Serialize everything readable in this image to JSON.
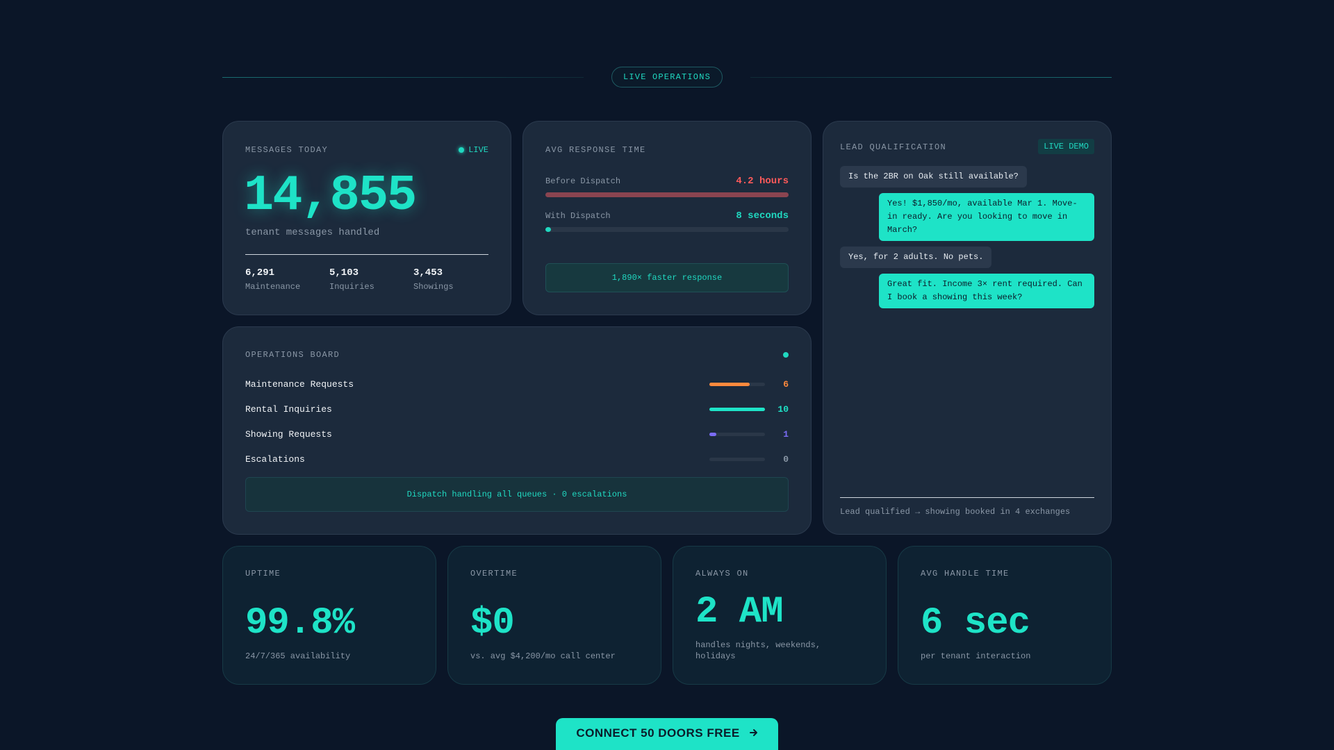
{
  "header": {
    "pill": "LIVE OPERATIONS"
  },
  "messages": {
    "label": "MESSAGES TODAY",
    "live": "LIVE",
    "count": "14,855",
    "subtitle": "tenant messages handled",
    "stats": [
      {
        "value": "6,291",
        "label": "Maintenance"
      },
      {
        "value": "5,103",
        "label": "Inquiries"
      },
      {
        "value": "3,453",
        "label": "Showings"
      }
    ]
  },
  "response": {
    "label": "AVG RESPONSE TIME",
    "before_label": "Before Dispatch",
    "before_value": "4.2 hours",
    "with_label": "With Dispatch",
    "with_value": "8 seconds",
    "faster": "1,890× faster response"
  },
  "ops": {
    "label": "OPERATIONS BOARD",
    "rows": [
      {
        "name": "Maintenance Requests",
        "count": "6",
        "fill": 0.72,
        "color": "#ff8a3d"
      },
      {
        "name": "Rental Inquiries",
        "count": "10",
        "fill": 1.0,
        "color": "#1ee3c7"
      },
      {
        "name": "Showing Requests",
        "count": "1",
        "fill": 0.12,
        "color": "#7b6cf6"
      },
      {
        "name": "Escalations",
        "count": "0",
        "fill": 0,
        "color": "#8a97a6"
      }
    ],
    "footer": "Dispatch handling all queues · 0 escalations"
  },
  "lead": {
    "label": "LEAD QUALIFICATION",
    "badge": "LIVE DEMO",
    "messages": [
      {
        "from": "tenant",
        "text": "Is the 2BR on Oak still available?"
      },
      {
        "from": "dispatch",
        "text": "Yes! $1,850/mo, available Mar 1. Move-in ready. Are you looking to move in March?"
      },
      {
        "from": "tenant",
        "text": "Yes, for 2 adults. No pets."
      },
      {
        "from": "dispatch",
        "text": "Great fit. Income 3× rent required. Can I book a showing this week?"
      }
    ],
    "note": "Lead qualified → showing booked in 4 exchanges"
  },
  "stat_cards": [
    {
      "label": "UPTIME",
      "value": "99.8%",
      "sub": "24/7/365 availability"
    },
    {
      "label": "OVERTIME",
      "value": "$0",
      "sub": "vs. avg $4,200/mo call center"
    },
    {
      "label": "ALWAYS ON",
      "value": "2 AM",
      "sub": "handles nights, weekends, holidays"
    },
    {
      "label": "AVG HANDLE TIME",
      "value": "6 sec",
      "sub": "per tenant interaction"
    }
  ],
  "cta": {
    "label": "CONNECT 50 DOORS FREE",
    "icon": "arrow-right-icon"
  },
  "colors": {
    "accent": "#1ee3c7",
    "danger": "#ff5a5a",
    "background": "#0b1628"
  }
}
